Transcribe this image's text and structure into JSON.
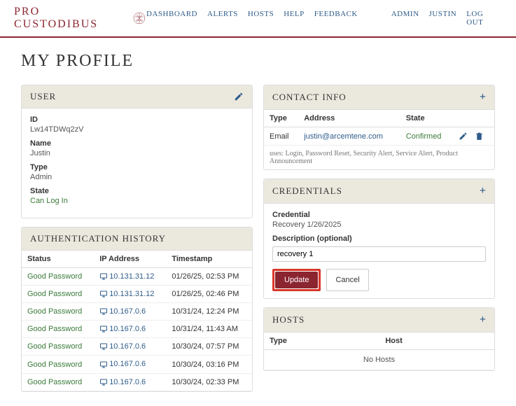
{
  "brand": "PRO CUSTODIBUS",
  "nav": {
    "dashboard": "DASHBOARD",
    "alerts": "ALERTS",
    "hosts": "HOSTS",
    "help": "HELP",
    "feedback": "FEEDBACK",
    "admin": "ADMIN",
    "user": "JUSTIN",
    "logout": "LOG OUT"
  },
  "page_title": "MY PROFILE",
  "user_panel": {
    "title": "USER",
    "id_label": "ID",
    "id_value": "Lw14TDWq2zV",
    "name_label": "Name",
    "name_value": "Justin",
    "type_label": "Type",
    "type_value": "Admin",
    "state_label": "State",
    "state_value": "Can Log In"
  },
  "auth_history": {
    "title": "AUTHENTICATION HISTORY",
    "col_status": "Status",
    "col_ip": "IP Address",
    "col_ts": "Timestamp",
    "rows": [
      {
        "status": "Good Password",
        "ip": "10.131.31.12",
        "ts": "01/26/25, 02:53 PM"
      },
      {
        "status": "Good Password",
        "ip": "10.131.31.12",
        "ts": "01/26/25, 02:46 PM"
      },
      {
        "status": "Good Password",
        "ip": "10.167.0.6",
        "ts": "10/31/24, 12:24 PM"
      },
      {
        "status": "Good Password",
        "ip": "10.167.0.6",
        "ts": "10/31/24, 11:43 AM"
      },
      {
        "status": "Good Password",
        "ip": "10.167.0.6",
        "ts": "10/30/24, 07:57 PM"
      },
      {
        "status": "Good Password",
        "ip": "10.167.0.6",
        "ts": "10/30/24, 03:16 PM"
      },
      {
        "status": "Good Password",
        "ip": "10.167.0.6",
        "ts": "10/30/24, 02:33 PM"
      }
    ]
  },
  "contact": {
    "title": "CONTACT INFO",
    "col_type": "Type",
    "col_address": "Address",
    "col_state": "State",
    "row": {
      "type": "Email",
      "address": "justin@arcemtene.com",
      "state": "Confirmed"
    },
    "uses": "uses: Login, Password Reset, Security Alert, Service Alert, Product Announcement"
  },
  "credentials": {
    "title": "CREDENTIALS",
    "credential_label": "Credential",
    "credential_value": "Recovery 1/26/2025",
    "description_label": "Description (optional)",
    "description_value": "recovery 1",
    "update": "Update",
    "cancel": "Cancel"
  },
  "hosts_panel": {
    "title": "HOSTS",
    "col_type": "Type",
    "col_host": "Host",
    "empty": "No Hosts"
  }
}
